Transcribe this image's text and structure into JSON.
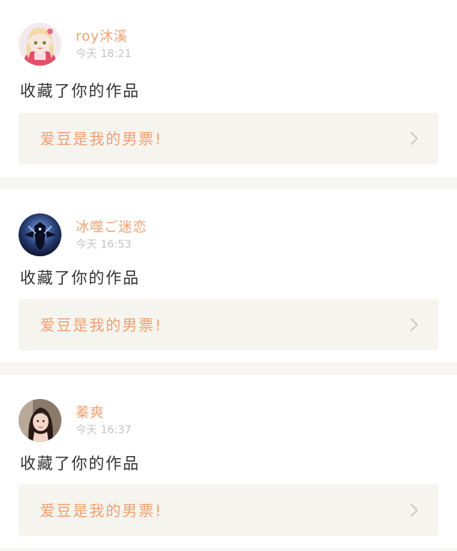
{
  "notifications": [
    {
      "username": "roy沐溪",
      "time": "今天 18:21",
      "action": "收藏了你的作品",
      "work_title": "爱豆是我的男票!",
      "avatar_icon": "anime-girl-avatar-icon"
    },
    {
      "username": "冰噬ご迷恋",
      "time": "今天 16:53",
      "action": "收藏了你的作品",
      "work_title": "爱豆是我的男票!",
      "avatar_icon": "dark-warrior-avatar-icon"
    },
    {
      "username": "蓁爽",
      "time": "今天 16:37",
      "action": "收藏了你的作品",
      "work_title": "爱豆是我的男票!",
      "avatar_icon": "girl-portrait-avatar-icon"
    }
  ],
  "colors": {
    "accent": "#f0a070",
    "background": "#f6f5f3",
    "card": "#ffffff",
    "link_bg": "#f5f4ee",
    "muted": "#c4c4c4",
    "text": "#333333"
  }
}
